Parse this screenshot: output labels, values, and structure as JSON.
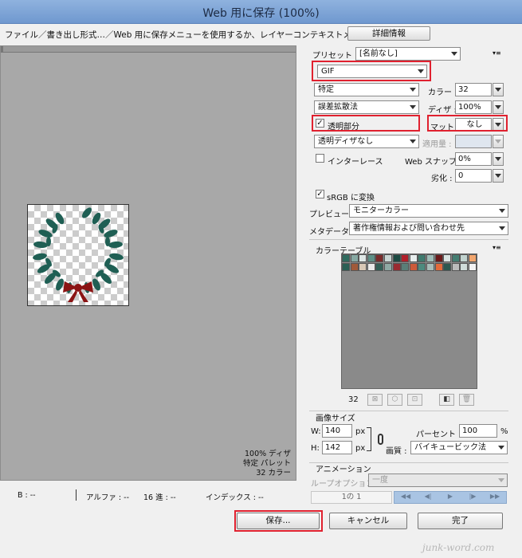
{
  "window": {
    "title": "Web 用に保存 (100%)"
  },
  "infobar": {
    "message": "ファイル／書き出し形式…／Web 用に保存メニューを使用するか、レイヤーコンテキストメニューを使用。",
    "detail_button": "詳細情報"
  },
  "preview": {
    "stats": [
      "100% ディザ",
      "特定 パレット",
      "32 カラー"
    ]
  },
  "status": {
    "b": "B : --",
    "alpha": "アルファ : --",
    "hex": "16 進 : --",
    "index": "インデックス : --"
  },
  "settings": {
    "preset_label": "プリセット :",
    "preset_value": "[名前なし]",
    "format": "GIF",
    "palette": "特定",
    "color_label": "カラー :",
    "color_value": "32",
    "dither_algorithm": "誤差拡散法",
    "dither_label": "ディザ :",
    "dither_value": "100%",
    "transparency_label": "透明部分",
    "transparency_checked": true,
    "matte_label": "マット :",
    "matte_value": "なし",
    "transparency_dither": "透明ディザなし",
    "amount_label": "適用量 :",
    "amount_value": "",
    "interlace_label": "インターレース",
    "interlace_checked": false,
    "websnap_label": "Web スナップ :",
    "websnap_value": "0%",
    "lossy_label": "劣化 :",
    "lossy_value": "0",
    "srgb_label": "sRGB に変換",
    "srgb_checked": true,
    "preview_label": "プレビュー :",
    "preview_value": "モニターカラー",
    "metadata_label": "メタデータ :",
    "metadata_value": "著作権情報および問い合わせ先"
  },
  "color_table": {
    "title": "カラーテーブル",
    "count": "32",
    "colors": [
      "#2f6b5e",
      "#86a8a2",
      "#dfe7e6",
      "#5e8f86",
      "#7a2a2a",
      "#c9d6d4",
      "#1c4a42",
      "#b01f2a",
      "#e8eeee",
      "#3f7a6e",
      "#9fbdb8",
      "#6b1a1a",
      "#d9e4e2",
      "#447e72",
      "#c1d3cf",
      "#f2a66e",
      "#2a5f54",
      "#a05a3a",
      "#d8c8b6",
      "#e9e9e9",
      "#325f56",
      "#8fa9a4",
      "#9a2a30",
      "#5a7e78",
      "#cc5a3a",
      "#4d8a7e",
      "#a8bdb9",
      "#e36a3a",
      "#2c5850",
      "#bbbbbb",
      "#d0dcda",
      "#f4f4f4"
    ]
  },
  "image_size": {
    "title": "画像サイズ",
    "w_label": "W:",
    "w_value": "140",
    "h_label": "H:",
    "h_value": "142",
    "unit": "px",
    "percent_label": "パーセント :",
    "percent_value": "100",
    "percent_unit": "%",
    "quality_label": "画質 :",
    "quality_value": "バイキュービック法"
  },
  "animation": {
    "title": "アニメーション",
    "loop_label": "ループオプション :",
    "loop_value": "一度",
    "frame": "1の 1"
  },
  "buttons": {
    "save": "保存...",
    "cancel": "キャンセル",
    "done": "完了"
  },
  "watermark": "junk-word.com",
  "accent_color": "#e0212f"
}
